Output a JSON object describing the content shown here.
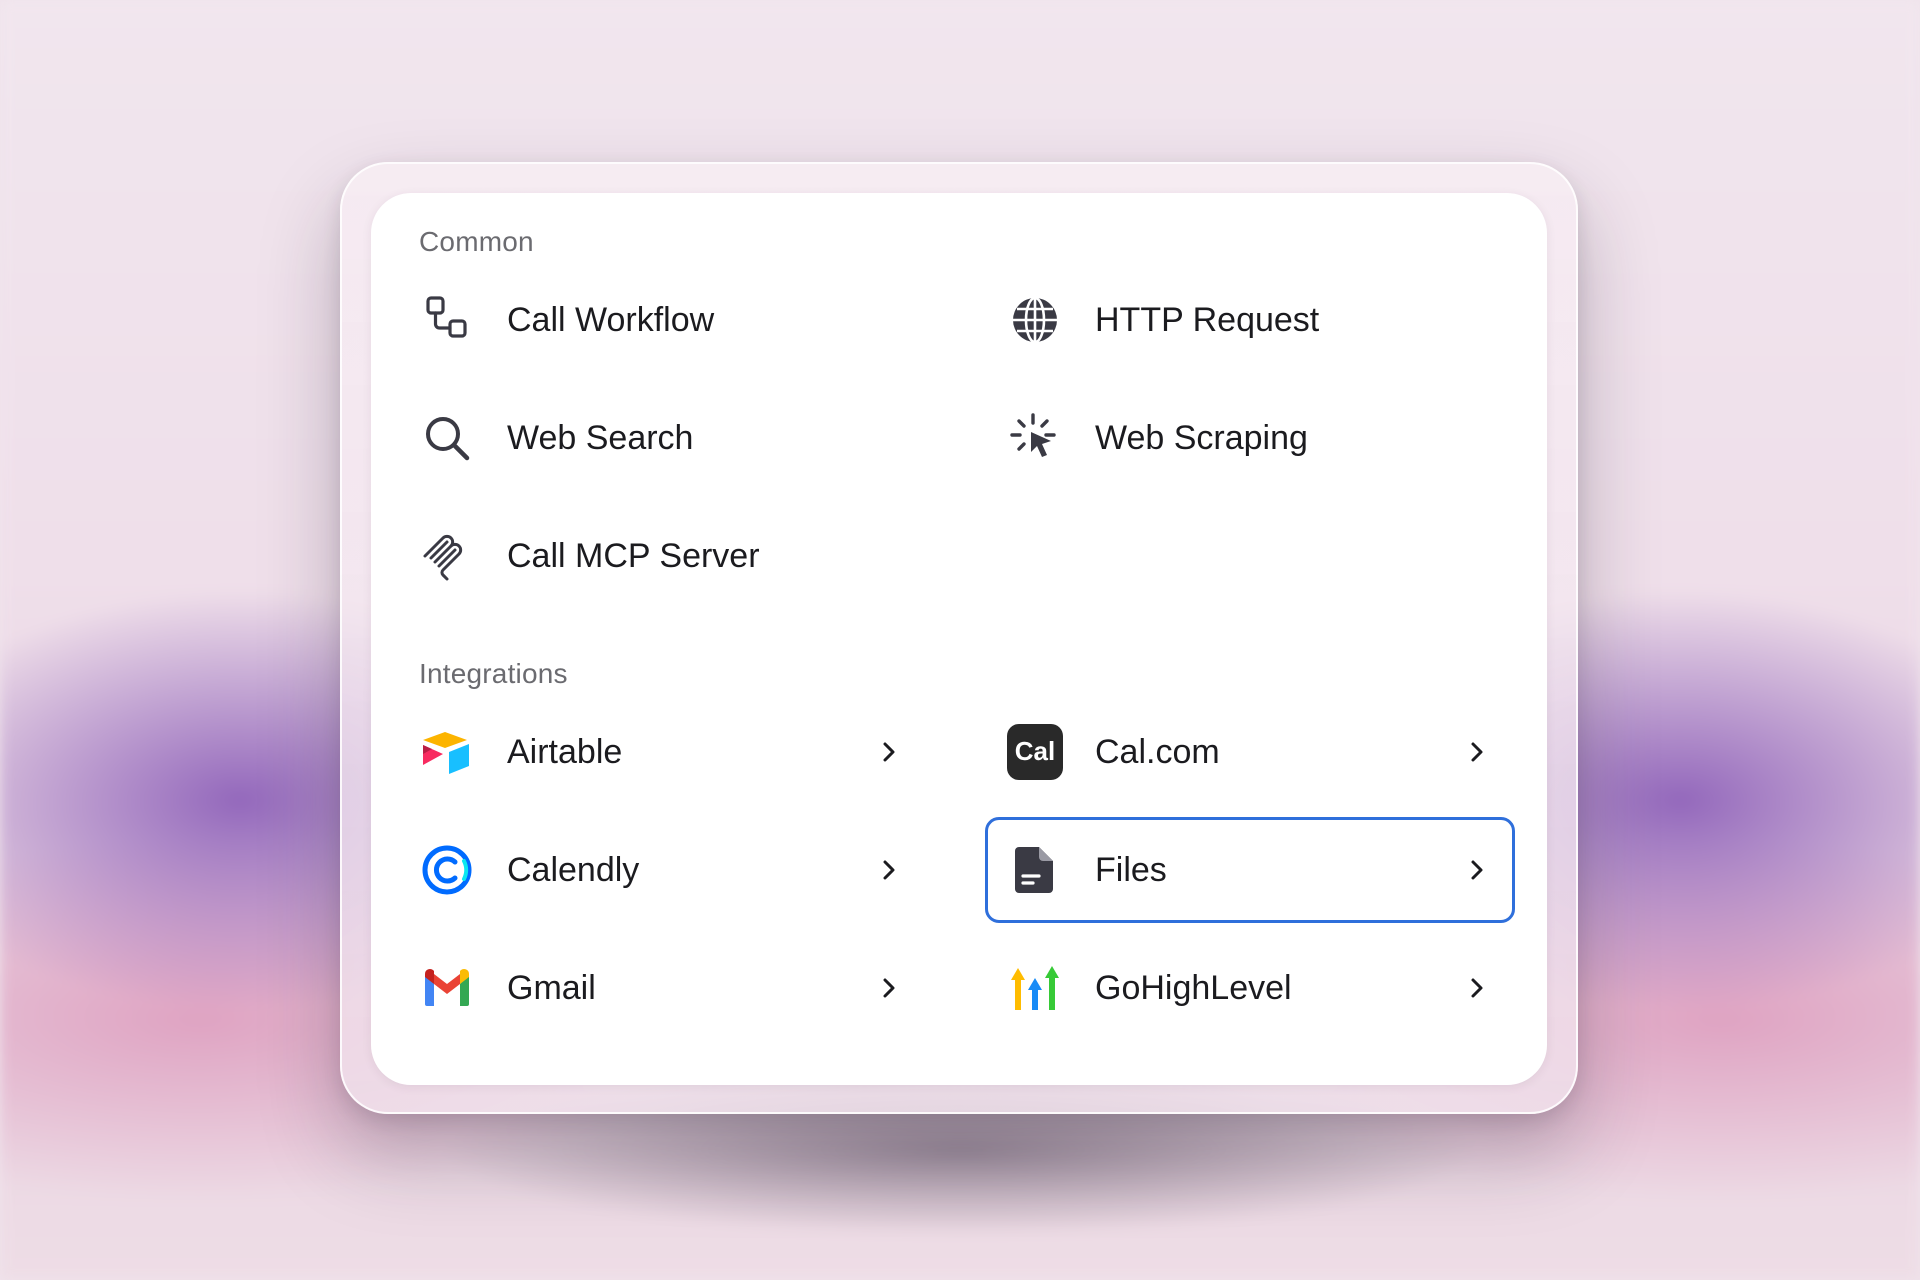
{
  "sections": {
    "common": {
      "label": "Common",
      "items": [
        {
          "label": "Call Workflow",
          "icon": "workflow-icon"
        },
        {
          "label": "HTTP Request",
          "icon": "globe-icon"
        },
        {
          "label": "Web Search",
          "icon": "search-icon"
        },
        {
          "label": "Web Scraping",
          "icon": "click-cursor-icon"
        },
        {
          "label": "Call MCP Server",
          "icon": "mcp-icon"
        }
      ]
    },
    "integrations": {
      "label": "Integrations",
      "items": [
        {
          "label": "Airtable",
          "icon": "airtable-logo-icon",
          "has_submenu": true
        },
        {
          "label": "Cal.com",
          "icon": "calcom-logo-icon",
          "logo_text": "Cal",
          "has_submenu": true
        },
        {
          "label": "Calendly",
          "icon": "calendly-logo-icon",
          "has_submenu": true
        },
        {
          "label": "Files",
          "icon": "file-icon",
          "has_submenu": true,
          "focused": true
        },
        {
          "label": "Gmail",
          "icon": "gmail-logo-icon",
          "has_submenu": true
        },
        {
          "label": "GoHighLevel",
          "icon": "gohighlevel-logo-icon",
          "has_submenu": true
        }
      ]
    }
  },
  "colors": {
    "focus_ring": "#2f6fdb",
    "label_text": "#1b1b1f",
    "section_text": "#6b6b70",
    "icon_gray": "#3a3a44"
  }
}
